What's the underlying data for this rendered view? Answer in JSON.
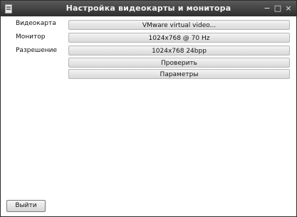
{
  "window": {
    "title": "Настройка видеокарты и монитора",
    "controls": {
      "minimize": "−",
      "maximize": "□",
      "close": "×"
    }
  },
  "rows": [
    {
      "label": "Видеокарта",
      "value": "VMware virtual video..."
    },
    {
      "label": "Монитор",
      "value": "1024x768 @ 70 Hz"
    },
    {
      "label": "Разрешение",
      "value": "1024x768 24bpp"
    }
  ],
  "actions": {
    "test_label": "Проверить",
    "params_label": "Параметры",
    "exit_label": "Выйти"
  },
  "colors": {
    "titlebar": "#3a3a3a",
    "button_face": "#e4e4e4"
  }
}
